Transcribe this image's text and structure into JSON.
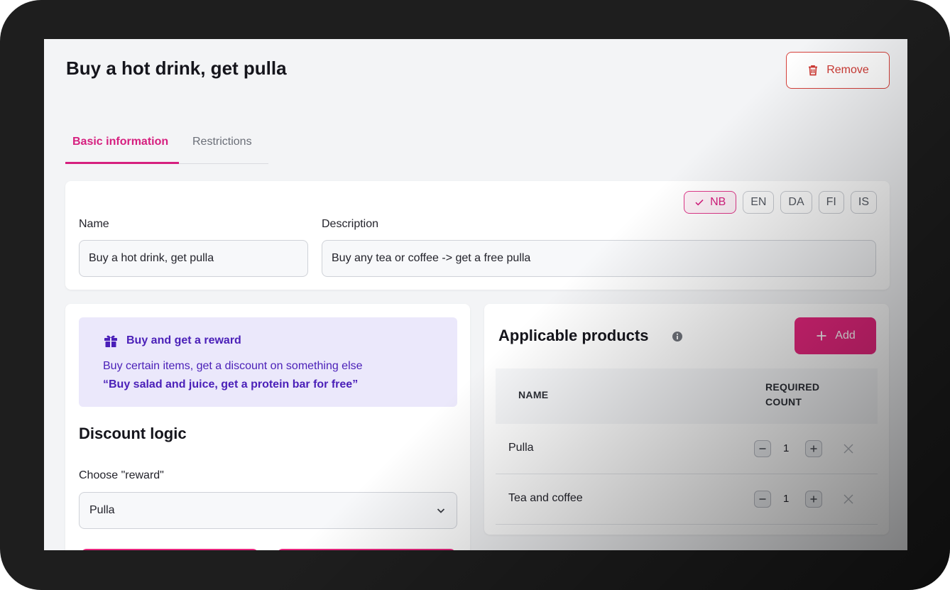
{
  "page": {
    "title": "Buy a hot drink, get pulla",
    "remove_label": "Remove"
  },
  "tabs": [
    {
      "label": "Basic information",
      "active": true
    },
    {
      "label": "Restrictions",
      "active": false
    }
  ],
  "languages": [
    {
      "code": "NB",
      "active": true
    },
    {
      "code": "EN",
      "active": false
    },
    {
      "code": "DA",
      "active": false
    },
    {
      "code": "FI",
      "active": false
    },
    {
      "code": "IS",
      "active": false
    }
  ],
  "form": {
    "name_label": "Name",
    "name_value": "Buy a hot drink, get pulla",
    "description_label": "Description",
    "description_value": "Buy any tea or coffee -> get a free pulla"
  },
  "promo": {
    "title": "Buy and get a reward",
    "subtitle": "Buy certain items, get a discount on something else",
    "example": "“Buy salad and juice, get a protein bar for free”"
  },
  "discount": {
    "section_title": "Discount logic",
    "reward_label": "Choose \"reward\"",
    "reward_value": "Pulla"
  },
  "products": {
    "title": "Applicable products",
    "add_label": "Add",
    "columns": {
      "name": "NAME",
      "required_count": "REQUIRED COUNT"
    },
    "rows": [
      {
        "name": "Pulla",
        "count": "1"
      },
      {
        "name": "Tea and coffee",
        "count": "1"
      }
    ]
  },
  "colors": {
    "accent": "#e8277f",
    "accent_text": "#d61f7f",
    "danger": "#cf3a34",
    "promo_bg": "#ebe8fb",
    "promo_text": "#4a1fb8"
  },
  "icons": [
    "trash-icon",
    "check-icon",
    "gift-icon",
    "chevron-down-icon",
    "info-icon",
    "plus-icon",
    "minus-icon",
    "close-icon"
  ]
}
